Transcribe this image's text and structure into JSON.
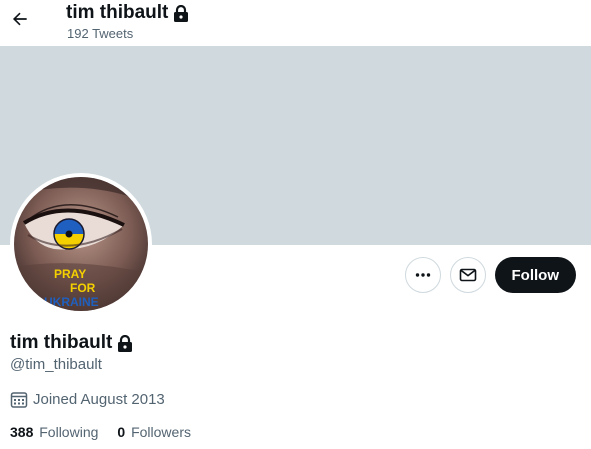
{
  "header": {
    "name": "tim thibault",
    "tweet_count": "192 Tweets"
  },
  "avatar": {
    "text_lines": [
      "PRAY",
      "FOR",
      "UKRAINE"
    ]
  },
  "actions": {
    "more_icon": "more-horizontal-icon",
    "message_icon": "envelope-icon",
    "follow_label": "Follow"
  },
  "profile": {
    "display_name": "tim thibault",
    "handle": "@tim_thibault",
    "joined": "Joined August 2013",
    "following_count": "388",
    "following_label": "Following",
    "followers_count": "0",
    "followers_label": "Followers"
  },
  "colors": {
    "banner": "#cfd9de",
    "follow_button": "#0f1419",
    "secondary_text": "#536471",
    "ukraine_blue": "#1f5fbf",
    "ukraine_yellow": "#f4d000"
  }
}
